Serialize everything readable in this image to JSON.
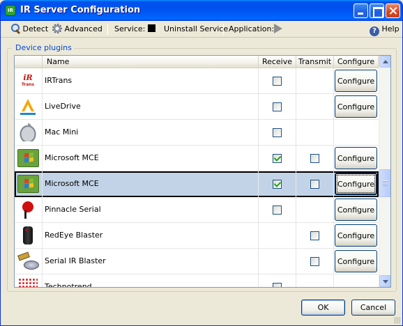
{
  "window": {
    "title": "IR Server Configuration",
    "app_icon_text": "IR"
  },
  "toolbar": {
    "detect_label": "Detect",
    "advanced_label": "Advanced",
    "service_label": "Service:",
    "uninstall_label": "Uninstall Service",
    "application_label": "Application:",
    "help_label": "Help"
  },
  "group": {
    "title": "Device plugins"
  },
  "grid": {
    "columns": {
      "name": "Name",
      "receive": "Receive",
      "transmit": "Transmit",
      "configure": "Configure"
    },
    "rows": [
      {
        "icon": "irtrans-logo",
        "name": "IRTrans",
        "receive": false,
        "transmit": null,
        "configure": "Configure"
      },
      {
        "icon": "livedrive-logo",
        "name": "LiveDrive",
        "receive": false,
        "transmit": null,
        "configure": "Configure"
      },
      {
        "icon": "apple-logo",
        "name": "Mac Mini",
        "receive": false,
        "transmit": null,
        "configure": null
      },
      {
        "icon": "windows-logo",
        "name": "Microsoft MCE",
        "receive": true,
        "transmit": false,
        "configure": "Configure"
      },
      {
        "icon": "windows-logo",
        "name": "Microsoft MCE",
        "receive": true,
        "transmit": false,
        "configure": "Configure",
        "selected": true
      },
      {
        "icon": "pinnacle-logo",
        "name": "Pinnacle Serial",
        "receive": false,
        "transmit": null,
        "configure": "Configure"
      },
      {
        "icon": "redeye-logo",
        "name": "RedEye Blaster",
        "receive": null,
        "transmit": false,
        "configure": "Configure"
      },
      {
        "icon": "serial-blaster-logo",
        "name": "Serial IR Blaster",
        "receive": null,
        "transmit": false,
        "configure": "Configure"
      },
      {
        "icon": "technotrend-logo",
        "name": "Technotrend",
        "receive": false,
        "transmit": null,
        "configure": null
      }
    ]
  },
  "irtrans_logo": {
    "top": "iR",
    "sub": "Trans"
  },
  "buttons": {
    "ok": "OK",
    "cancel": "Cancel"
  }
}
